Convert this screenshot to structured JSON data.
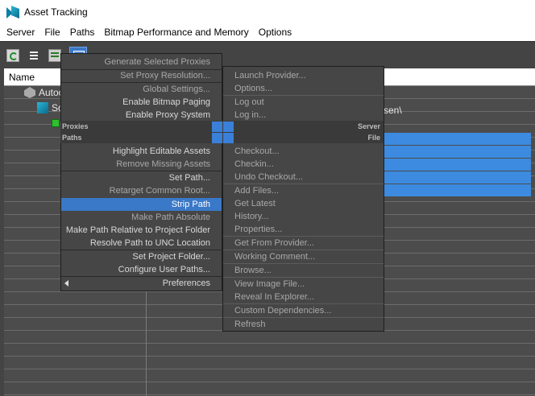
{
  "window": {
    "title": "Asset Tracking"
  },
  "menubar": [
    "Server",
    "File",
    "Paths",
    "Bitmap Performance and Memory",
    "Options"
  ],
  "toolbar": {
    "icons": [
      "refresh-icon",
      "list-icon",
      "table-icon",
      "window-icon"
    ]
  },
  "list": {
    "column_name": "Name",
    "items": [
      {
        "label": "Autoc",
        "icon": "autodesk-icon"
      },
      {
        "label": "So",
        "icon": "scene-icon"
      },
      {
        "label": "",
        "icon": "bitmap-icon"
      }
    ],
    "path_fragment": "sen\\"
  },
  "context_menu": {
    "left_top": [
      "Generate Selected Proxies",
      "Set Proxy Resolution...",
      "Global Settings...",
      "Enable Bitmap Paging",
      "Enable Proxy System"
    ],
    "right_top": [
      "Launch Provider...",
      "Options...",
      "Log out",
      "Log in..."
    ],
    "bands": [
      {
        "left": "Proxies",
        "right": "Server"
      },
      {
        "left": "Paths",
        "right": "File"
      }
    ],
    "left_bottom": [
      "Highlight Editable Assets",
      "Remove Missing Assets",
      "Set Path...",
      "Retarget Common Root...",
      "Strip Path",
      "Make Path Absolute",
      "Make Path Relative to Project Folder",
      "Resolve Path to UNC Location",
      "Set Project Folder...",
      "Configure User Paths...",
      "Preferences"
    ],
    "right_bottom": [
      "Checkout...",
      "Checkin...",
      "Undo Checkout...",
      "Add Files...",
      "Get Latest",
      "History...",
      "Properties...",
      "Get From Provider...",
      "Working Comment...",
      "Browse...",
      "View Image File...",
      "Reveal In Explorer...",
      "Custom Dependencies...",
      "Refresh"
    ],
    "highlighted": "Strip Path"
  },
  "colors": {
    "highlight": "#3a78c8",
    "selection": "#3c8be0",
    "background": "#444444"
  }
}
